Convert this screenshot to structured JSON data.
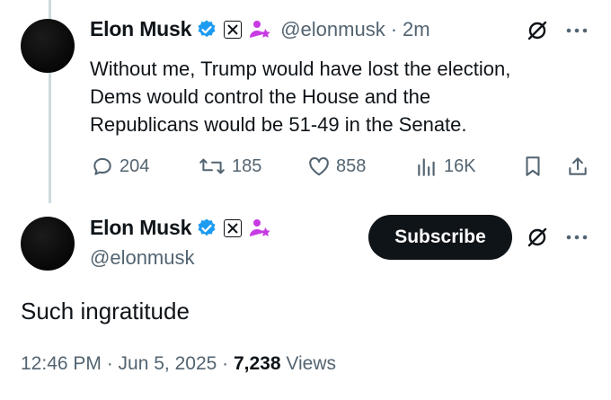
{
  "reply_tweet": {
    "display_name": "Elon Musk",
    "handle": "@elonmusk",
    "separator": "·",
    "time": "2m",
    "text_lines": [
      "Without me, Trump would have lost the election,",
      "Dems would control the House and the",
      "Republicans would be 51-49 in the Senate."
    ],
    "actions": {
      "replies": "204",
      "reposts": "185",
      "likes": "858",
      "views": "16K"
    }
  },
  "main_tweet": {
    "display_name": "Elon Musk",
    "handle": "@elonmusk",
    "subscribe_label": "Subscribe",
    "text": "Such ingratitude",
    "timestamp": "12:46 PM · Jun 5, 2025 · ",
    "views_count": "7,238",
    "views_label": " Views"
  },
  "colors": {
    "verified": "#1d9bf0",
    "affiliation": "#c73be3",
    "muted": "#536471",
    "text": "#0f1419"
  },
  "icons": [
    "verified-badge-icon",
    "x-logo-icon",
    "affiliation-icon",
    "grok-icon",
    "more-icon",
    "reply-icon",
    "repost-icon",
    "like-icon",
    "views-icon",
    "bookmark-icon",
    "share-icon"
  ]
}
